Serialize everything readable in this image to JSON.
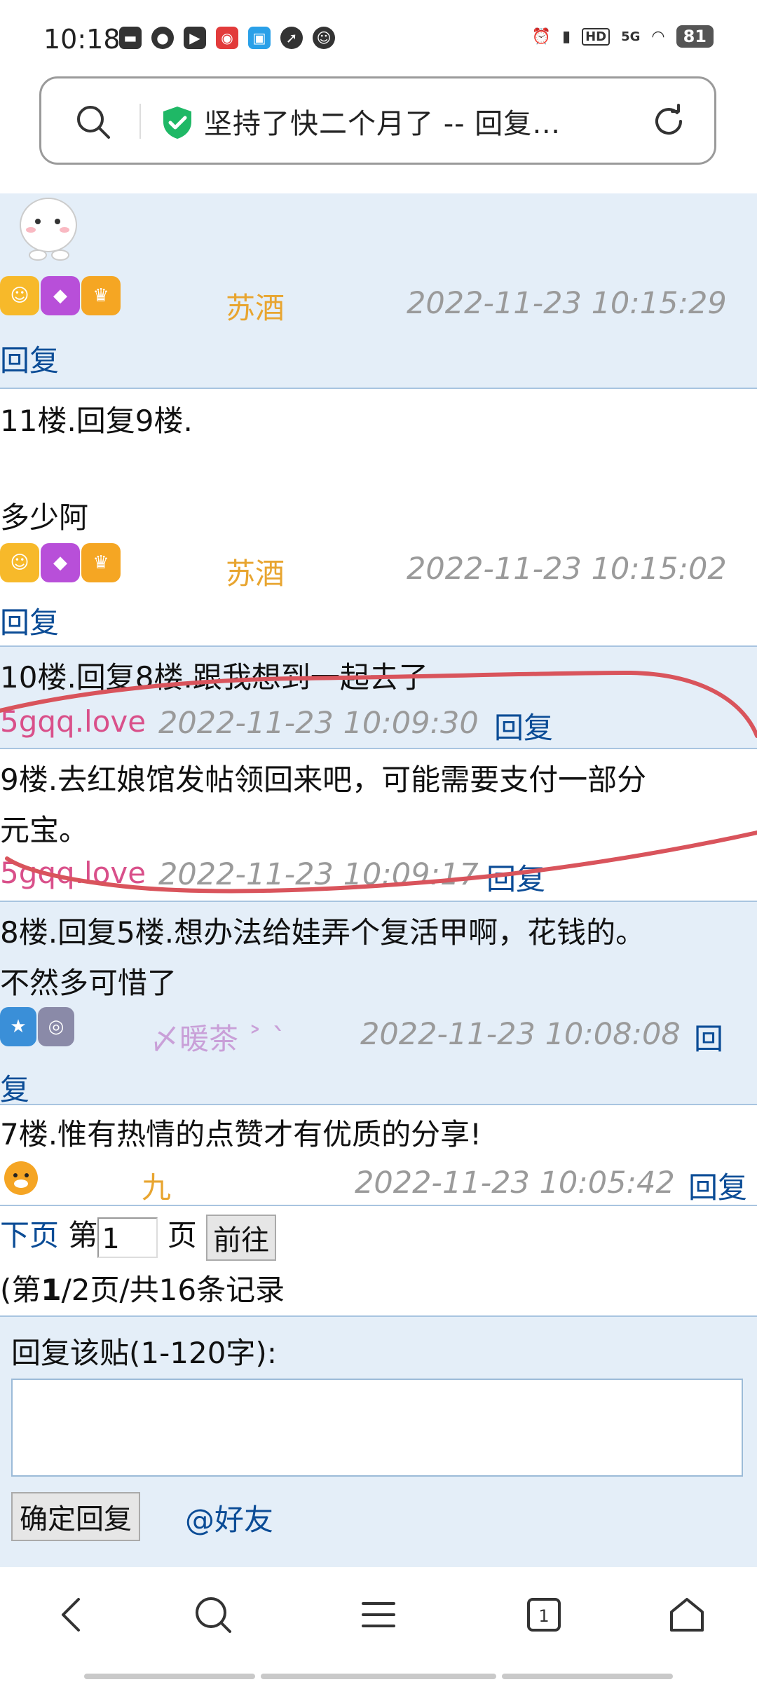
{
  "status": {
    "time": "10:18",
    "battery": "81",
    "network": "5G",
    "hd": "HD"
  },
  "urlbar": {
    "title": "坚持了快二个月了 -- 回复…"
  },
  "posts": [
    {
      "author": "苏酒",
      "time": "2022-11-23 10:15:29",
      "reply": "回复"
    },
    {
      "line1": "11楼.回复9楼.",
      "line2": "多少阿",
      "author": "苏酒",
      "time": "2022-11-23 10:15:02",
      "reply": "回复"
    },
    {
      "line1": "10楼.回复8楼.跟我想到一起去了",
      "author": "5gqq.love",
      "time": "2022-11-23 10:09:30",
      "reply": "回复"
    },
    {
      "line1": "9楼.去红娘馆发帖领回来吧，可能需要支付一部分",
      "line2": "元宝。",
      "author": "5gqq.love",
      "time": "2022-11-23 10:09:17",
      "reply": "回复"
    },
    {
      "line1": "8楼.回复5楼.想办法给娃弄个复活甲啊，花钱的。",
      "line2": "不然多可惜了",
      "author": "〆暖茶 ˃ ˋ",
      "time": "2022-11-23 10:08:08",
      "reply_a": "回",
      "reply_b": "复"
    },
    {
      "line1": "7楼.惟有热情的点赞才有优质的分享!",
      "author": "九",
      "time": "2022-11-23 10:05:42",
      "reply": "回复"
    }
  ],
  "pager": {
    "next": "下页",
    "pre": "第",
    "value": "1",
    "post": "页",
    "go": "前往",
    "summary_a": "(第",
    "summary_b": "1",
    "summary_c": "/2页/共16条记录"
  },
  "reply_form": {
    "label": "回复该贴(1-120字):",
    "submit": "确定回复",
    "friend": "@好友"
  },
  "colors": {
    "link": "#0b4c96",
    "time": "#9a9a9a",
    "blue_bg": "#e4eef8",
    "annotation": "#d9545c"
  }
}
